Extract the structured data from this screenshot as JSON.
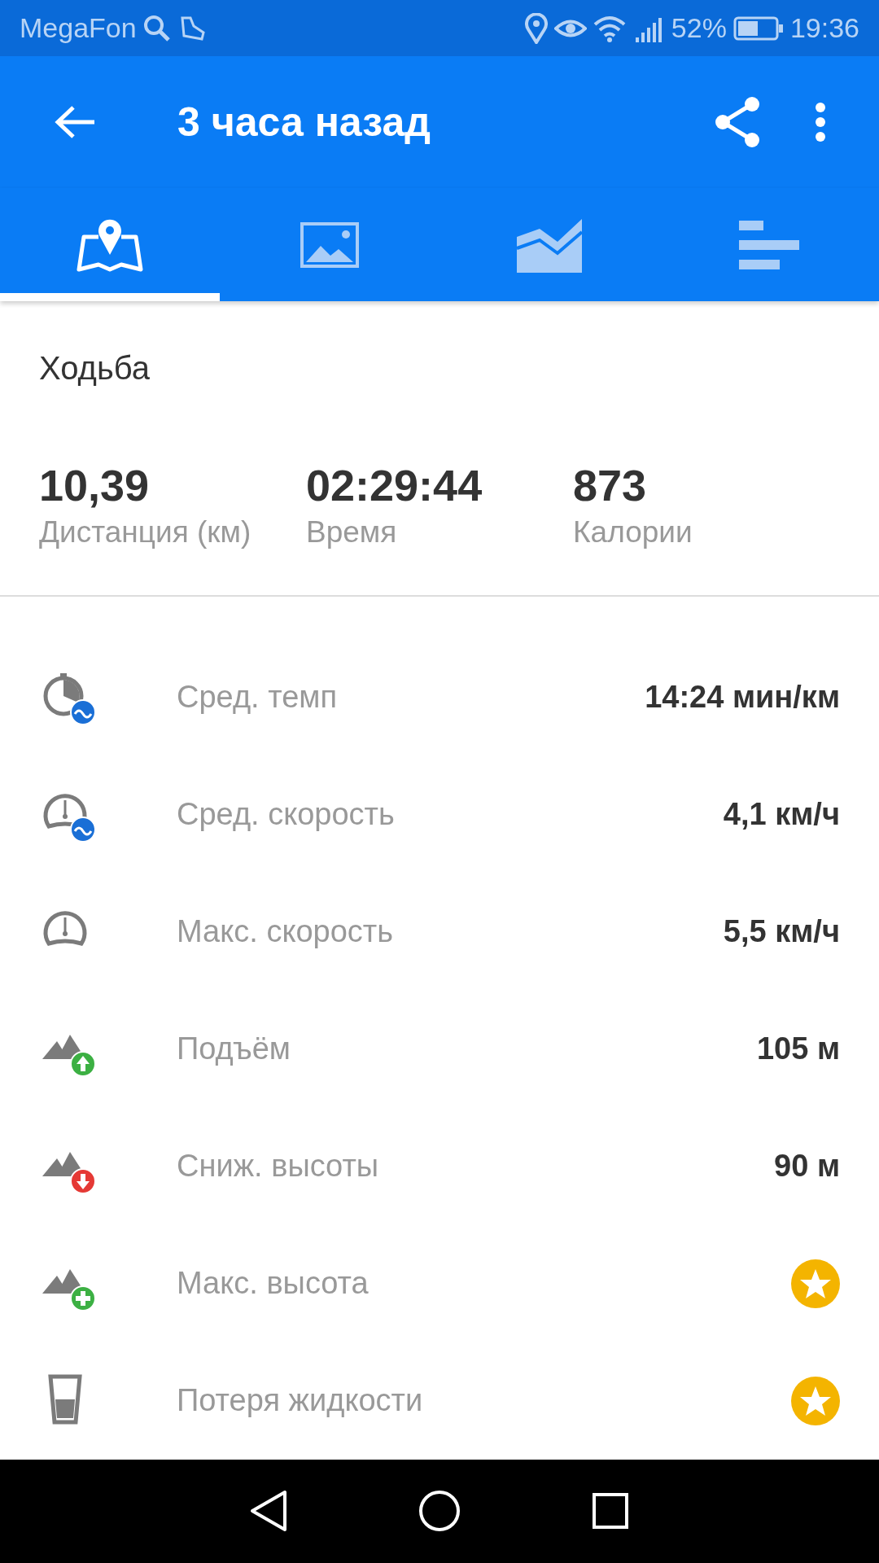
{
  "status_bar": {
    "carrier": "MegaFon",
    "battery": "52%",
    "time": "19:36"
  },
  "app_bar": {
    "title": "3 часа назад"
  },
  "tabs": [
    {
      "kind": "map",
      "selected": true
    },
    {
      "kind": "photos",
      "selected": false
    },
    {
      "kind": "chart",
      "selected": false
    },
    {
      "kind": "stats",
      "selected": false
    }
  ],
  "activity": "Ходьба",
  "summary": [
    {
      "value": "10,39",
      "label": "Дистанция (км)"
    },
    {
      "value": "02:29:44",
      "label": "Время"
    },
    {
      "value": "873",
      "label": "Калории"
    }
  ],
  "metrics": [
    {
      "kind": "pace",
      "label": "Сред. темп",
      "value": "14:24 мин/км",
      "locked": false
    },
    {
      "kind": "avg-speed",
      "label": "Сред. скорость",
      "value": "4,1 км/ч",
      "locked": false
    },
    {
      "kind": "max-speed",
      "label": "Макс. скорость",
      "value": "5,5 км/ч",
      "locked": false
    },
    {
      "kind": "ascent",
      "label": "Подъём",
      "value": "105 м",
      "locked": false
    },
    {
      "kind": "descent",
      "label": "Сниж. высоты",
      "value": "90 м",
      "locked": false
    },
    {
      "kind": "max-altitude",
      "label": "Макс. высота",
      "locked": true
    },
    {
      "kind": "water",
      "label": "Потеря жидкости",
      "locked": true
    }
  ]
}
